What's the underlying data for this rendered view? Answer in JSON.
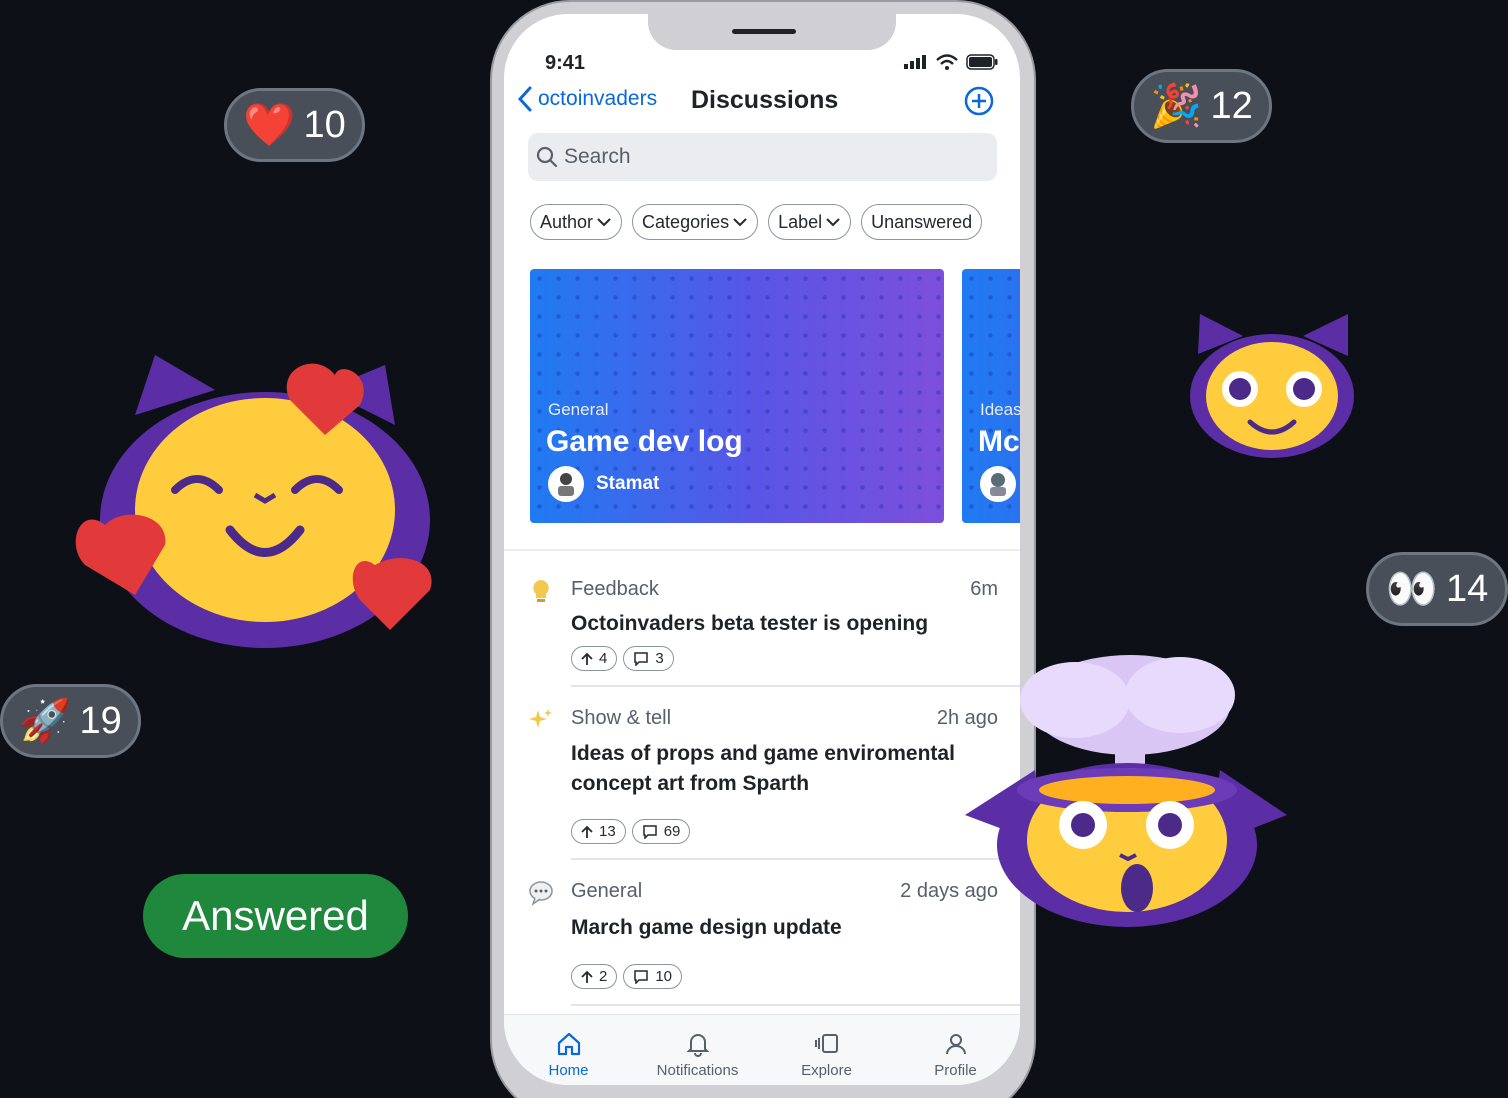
{
  "reactions": {
    "heart": {
      "emoji": "❤️",
      "count": "10"
    },
    "tada": {
      "emoji": "🎉",
      "count": "12"
    },
    "eyes": {
      "emoji": "👀",
      "count": "14"
    },
    "rocket": {
      "emoji": "🚀",
      "count": "19"
    }
  },
  "answered_label": "Answered",
  "status_bar": {
    "time": "9:41"
  },
  "nav": {
    "back_label": "octoinvaders",
    "title": "Discussions"
  },
  "search": {
    "placeholder": "Search"
  },
  "filters": [
    "Author",
    "Categories",
    "Label",
    "Unanswered"
  ],
  "featured": [
    {
      "category": "General",
      "title": "Game dev log",
      "author": "Stamat"
    },
    {
      "category": "Ideas",
      "title": "Mc"
    }
  ],
  "discussions": [
    {
      "category": "Feedback",
      "time": "6m",
      "title": "Octoinvaders beta tester is opening",
      "upvotes": "4",
      "comments": "3",
      "icon": "lightbulb-icon"
    },
    {
      "category": "Show & tell",
      "time": "2h ago",
      "title": "Ideas of props and game enviromental concept art from Sparth",
      "upvotes": "13",
      "comments": "69",
      "icon": "sparkles-icon"
    },
    {
      "category": "General",
      "time": "2 days ago",
      "title": "March game design update",
      "upvotes": "2",
      "comments": "10",
      "icon": "speech-bubble-icon"
    }
  ],
  "tabs": [
    {
      "label": "Home",
      "active": true
    },
    {
      "label": "Notifications"
    },
    {
      "label": "Explore"
    },
    {
      "label": "Profile"
    }
  ],
  "colors": {
    "accent": "#0969da",
    "answered": "#1f883d",
    "background": "#0d1117"
  }
}
